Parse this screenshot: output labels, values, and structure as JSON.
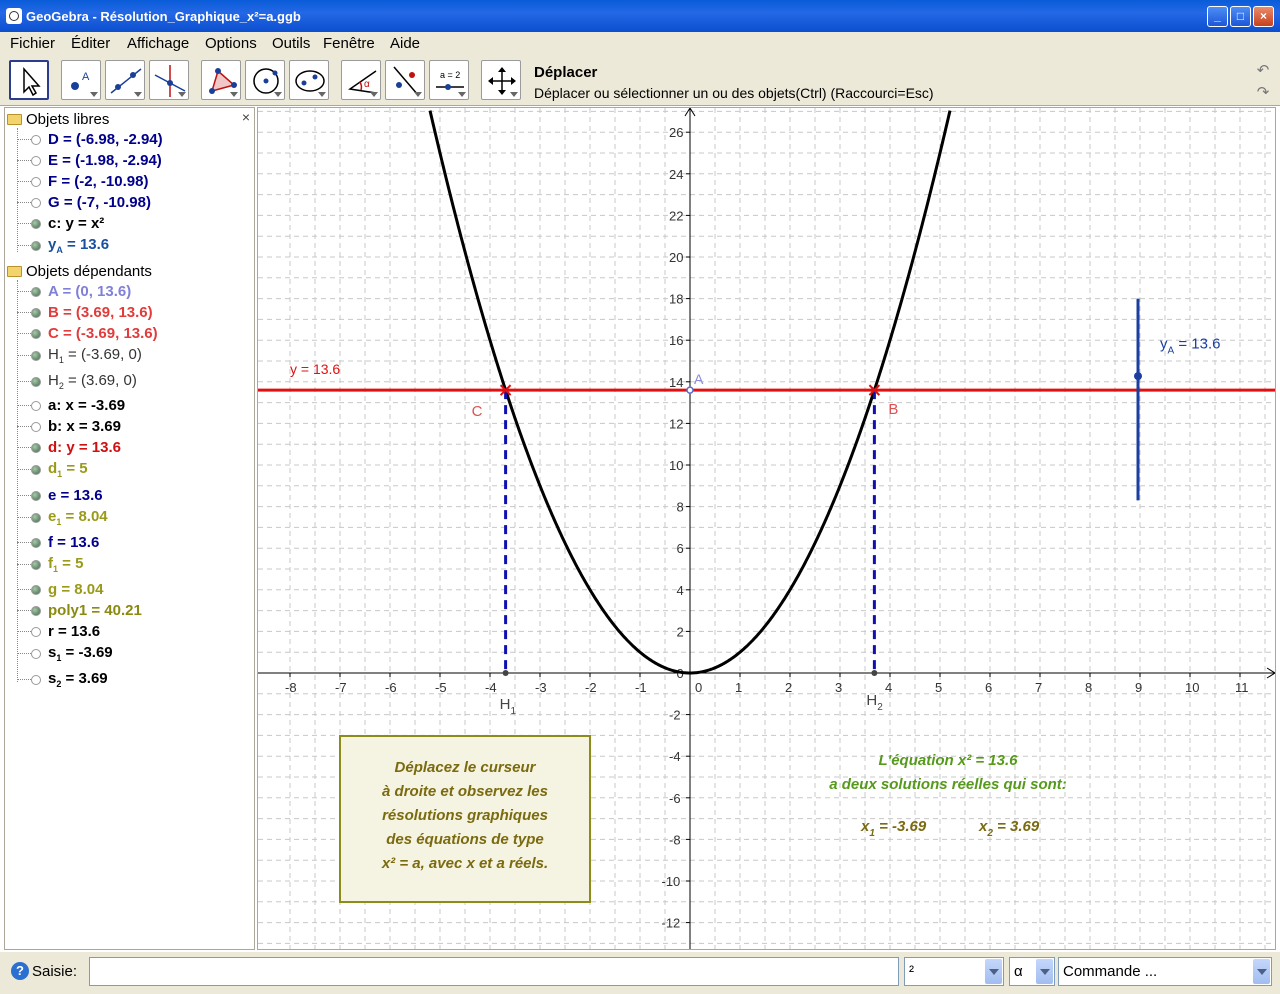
{
  "window": {
    "title": "GeoGebra - Résolution_Graphique_x²=a.ggb",
    "minimize": "_",
    "maximize": "□",
    "close": "×"
  },
  "menu": [
    "Fichier",
    "Éditer",
    "Affichage",
    "Options",
    "Outils",
    "Fenêtre",
    "Aide"
  ],
  "toolbar": {
    "tools": [
      "move-tool",
      "point-tool",
      "line-tool",
      "perpendicular-tool",
      "polygon-tool",
      "circle-tool",
      "conic-tool",
      "angle-tool",
      "reflect-tool",
      "slider-tool",
      "move-view-tool"
    ],
    "slider_label": "a = 2",
    "active_name": "Déplacer",
    "active_help": "Déplacer ou sélectionner un ou des objets(Ctrl) (Raccourci=Esc)",
    "undo": "↶",
    "redo": "↷"
  },
  "algebra": {
    "close": "×",
    "free_title": "Objets libres",
    "free": [
      {
        "text": "D = (-6.98, -2.94)",
        "color": "#00008b",
        "bold": true,
        "shown": false
      },
      {
        "text": "E = (-1.98, -2.94)",
        "color": "#00008b",
        "bold": true,
        "shown": false
      },
      {
        "text": "F = (-2, -10.98)",
        "color": "#00008b",
        "bold": true,
        "shown": false
      },
      {
        "text": "G = (-7, -10.98)",
        "color": "#00008b",
        "bold": true,
        "shown": false
      },
      {
        "text": "c: y = x²",
        "color": "#000000",
        "bold": true,
        "shown": true
      },
      {
        "main": "y",
        "sub": "A",
        "rest": " = 13.6",
        "color": "#1a4fa0",
        "bold": true,
        "shown": true
      }
    ],
    "dep_title": "Objets dépendants",
    "dependent": [
      {
        "text": "A = (0, 13.6)",
        "color": "#8080d8",
        "bold": true,
        "shown": true
      },
      {
        "text": "B = (3.69, 13.6)",
        "color": "#e03c3c",
        "bold": true,
        "shown": true
      },
      {
        "text": "C = (-3.69, 13.6)",
        "color": "#e03c3c",
        "bold": true,
        "shown": true
      },
      {
        "main": "H",
        "sub": "1",
        "rest": " = (-3.69, 0)",
        "color": "#333333",
        "bold": false,
        "shown": true
      },
      {
        "main": "H",
        "sub": "2",
        "rest": " = (3.69, 0)",
        "color": "#333333",
        "bold": false,
        "shown": true
      },
      {
        "text": "a: x = -3.69",
        "color": "#000000",
        "bold": true,
        "shown": false
      },
      {
        "text": "b: x = 3.69",
        "color": "#000000",
        "bold": true,
        "shown": false
      },
      {
        "text": "d: y = 13.6",
        "color": "#d01010",
        "bold": true,
        "shown": true
      },
      {
        "main": "d",
        "sub": "1",
        "rest": " = 5",
        "color": "#9a9a1a",
        "bold": true,
        "shown": true
      },
      {
        "text": "e = 13.6",
        "color": "#00008b",
        "bold": true,
        "shown": true
      },
      {
        "main": "e",
        "sub": "1",
        "rest": " = 8.04",
        "color": "#9a9a1a",
        "bold": true,
        "shown": true
      },
      {
        "text": "f = 13.6",
        "color": "#00008b",
        "bold": true,
        "shown": true
      },
      {
        "main": "f",
        "sub": "1",
        "rest": " = 5",
        "color": "#9a9a1a",
        "bold": true,
        "shown": true
      },
      {
        "text": "g = 8.04",
        "color": "#9a9a1a",
        "bold": true,
        "shown": true
      },
      {
        "text": "poly1 = 40.21",
        "color": "#8a8a10",
        "bold": true,
        "shown": true
      },
      {
        "text": "r = 13.6",
        "color": "#000000",
        "bold": true,
        "shown": false
      },
      {
        "main": "s",
        "sub": "1",
        "rest": " = -3.69",
        "color": "#000000",
        "bold": true,
        "shown": false
      },
      {
        "main": "s",
        "sub": "2",
        "rest": " = 3.69",
        "color": "#000000",
        "bold": true,
        "shown": false
      }
    ]
  },
  "graph": {
    "x_ticks": [
      "-8",
      "-7",
      "-6",
      "-5",
      "-4",
      "-3",
      "-2",
      "-1",
      "0",
      "1",
      "2",
      "3",
      "4",
      "5",
      "6",
      "7",
      "8",
      "9",
      "10",
      "11"
    ],
    "y_ticks": [
      "26",
      "24",
      "22",
      "20",
      "18",
      "16",
      "14",
      "12",
      "10",
      "8",
      "6",
      "4",
      "2",
      "0",
      "-2",
      "-4",
      "-6",
      "-8",
      "-10",
      "-12"
    ],
    "line_label": "y = 13.6",
    "point_A": "A",
    "point_B": "B",
    "point_C": "C",
    "h1_main": "H",
    "h1_sub": "1",
    "h2_main": "H",
    "h2_sub": "2",
    "slider_main": "y",
    "slider_sub": "A",
    "slider_rest": " = 13.6",
    "slider_value": 13.6,
    "instruction": [
      "Déplacez le curseur",
      "à droite et observez les",
      "résolutions graphiques",
      "des équations de type",
      "x² = a, avec x et a réels."
    ],
    "equation_line1": "L'équation x² = 13.6",
    "equation_line2": "a deux solutions réelles qui sont:",
    "x1_main": "x",
    "x1_sub": "1",
    "x1_rest": " = -3.69",
    "x2_main": "x",
    "x2_sub": "2",
    "x2_rest": " = 3.69",
    "colors": {
      "curve": "#000000",
      "line": "#e01010",
      "dash": "#1010b0",
      "slider": "#1a3fa0",
      "text_green": "#559a1a",
      "text_olive": "#7a6a10",
      "box_border": "#8c8c1a",
      "box_fill": "#f5f3e1"
    }
  },
  "input": {
    "help": "?",
    "label": "Saisie:",
    "value": "",
    "symbols": "²",
    "greek": "α",
    "commands": "Commande ..."
  }
}
